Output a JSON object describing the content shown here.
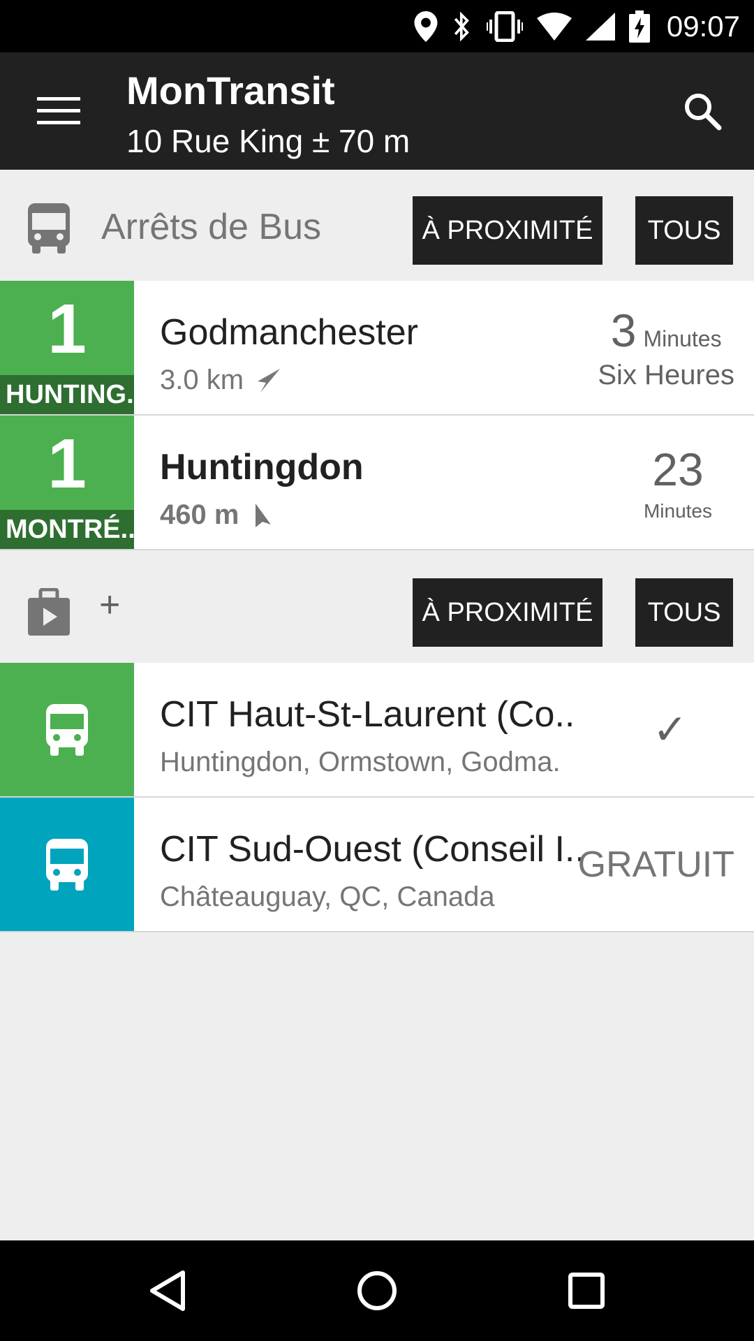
{
  "status_bar": {
    "time": "09:07",
    "icons": [
      "location-icon",
      "bluetooth-icon",
      "vibrate-icon",
      "wifi-icon",
      "signal-icon",
      "battery-charging-icon"
    ]
  },
  "app_bar": {
    "title": "MonTransit",
    "subtitle": "10 Rue King ± 70 m",
    "menu_icon": "menu-icon",
    "search_icon": "search-icon"
  },
  "bus_stops_section": {
    "title": "Arrêts de Bus",
    "icon": "bus-icon",
    "nearby_button": "À PROXIMITÉ",
    "all_button": "TOUS",
    "items": [
      {
        "route_number": "1",
        "direction": "HUNTING..",
        "stop_name": "Godmanchester",
        "distance": "3.0 km",
        "time_value": "3",
        "time_unit": "Minutes",
        "time_sub": "Six Heures",
        "color": "#4cb050",
        "dir_color": "#2e6e31"
      },
      {
        "route_number": "1",
        "direction": "MONTRÉ..",
        "stop_name": "Huntingdon",
        "distance": "460 m",
        "time_value": "23",
        "time_unit": "Minutes",
        "color": "#4cb050",
        "dir_color": "#2e6e31"
      }
    ]
  },
  "agencies_section": {
    "icon": "store-bag-icon",
    "plus": "+",
    "nearby_button": "À PROXIMITÉ",
    "all_button": "TOUS",
    "items": [
      {
        "name": "CIT Haut-St-Laurent (Co..",
        "location": "Huntingdon, Ormstown, Godma.",
        "status": "✓",
        "color": "#4cb050"
      },
      {
        "name": "CIT Sud-Ouest (Conseil I..",
        "location": "Châteauguay, QC, Canada",
        "status": "GRATUIT",
        "color": "#00a5bd"
      }
    ]
  },
  "nav_bar": {
    "icons": [
      "back-icon",
      "home-icon",
      "recents-icon"
    ]
  }
}
